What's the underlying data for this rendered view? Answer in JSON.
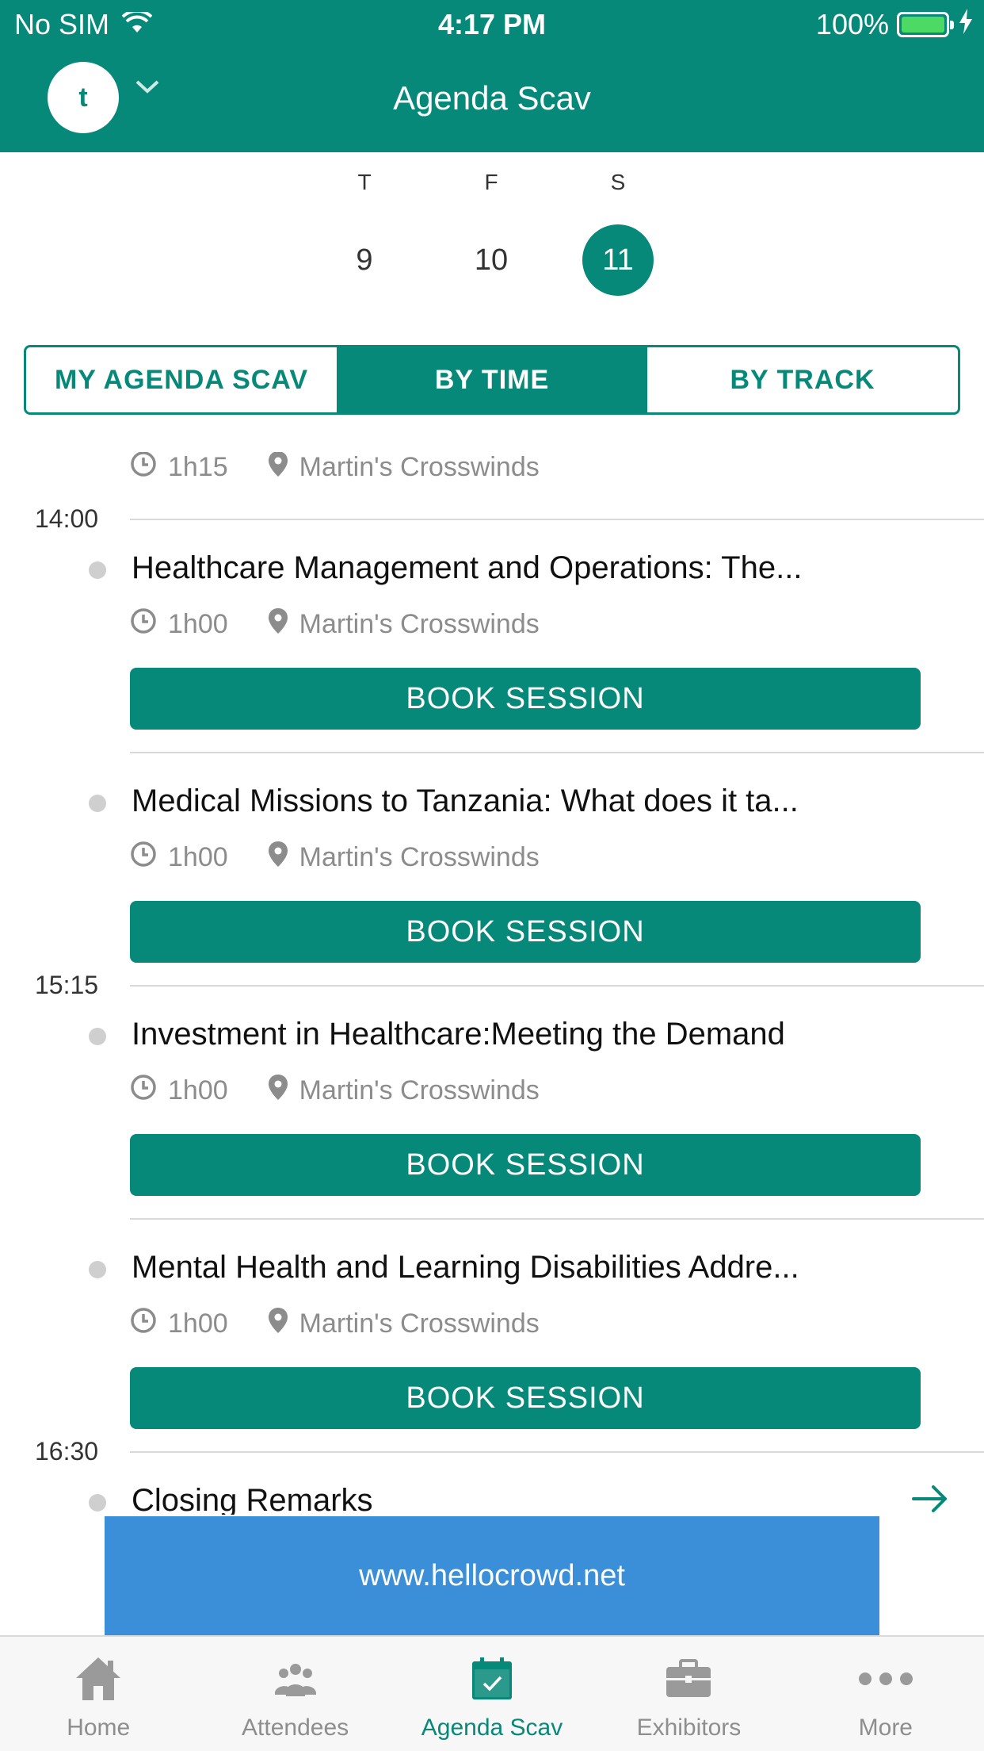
{
  "status_bar": {
    "carrier": "No SIM",
    "time": "4:17 PM",
    "battery": "100%"
  },
  "header": {
    "avatar_letter": "t",
    "title": "Agenda Scav"
  },
  "calendar": {
    "days": [
      {
        "dow": "T",
        "num": "9"
      },
      {
        "dow": "F",
        "num": "10"
      },
      {
        "dow": "S",
        "num": "11"
      }
    ],
    "selected": "11"
  },
  "segments": [
    "MY AGENDA SCAV",
    "BY TIME",
    "BY TRACK"
  ],
  "active_segment": "BY TIME",
  "partial_item": {
    "duration": "1h15",
    "location": "Martin's Crosswinds"
  },
  "times": [
    "14:00",
    "15:15",
    "16:30"
  ],
  "sessions": [
    {
      "title": "Healthcare Management and Operations: The...",
      "duration": "1h00",
      "location": "Martin's Crosswinds",
      "button": "BOOK SESSION"
    },
    {
      "title": "Medical Missions to Tanzania: What does it ta...",
      "duration": "1h00",
      "location": "Martin's Crosswinds",
      "button": "BOOK SESSION"
    },
    {
      "title": "Investment in Healthcare:Meeting the Demand",
      "duration": "1h00",
      "location": "Martin's Crosswinds",
      "button": "BOOK SESSION"
    },
    {
      "title": "Mental Health and Learning Disabilities Addre...",
      "duration": "1h00",
      "location": "Martin's Crosswinds",
      "button": "BOOK SESSION"
    },
    {
      "title": "Closing Remarks"
    }
  ],
  "banner": {
    "text": "www.hellocrowd.net"
  },
  "tabs": [
    {
      "label": "Home",
      "icon": "home-icon"
    },
    {
      "label": "Attendees",
      "icon": "attendees-icon"
    },
    {
      "label": "Agenda Scav",
      "icon": "calendar-check-icon"
    },
    {
      "label": "Exhibitors",
      "icon": "briefcase-icon"
    },
    {
      "label": "More",
      "icon": "more-dots-icon"
    }
  ],
  "active_tab": "Agenda Scav",
  "colors": {
    "primary": "#07897a",
    "banner": "#3b8fd9",
    "muted": "#8c8c8c",
    "battery": "#4cd964"
  }
}
